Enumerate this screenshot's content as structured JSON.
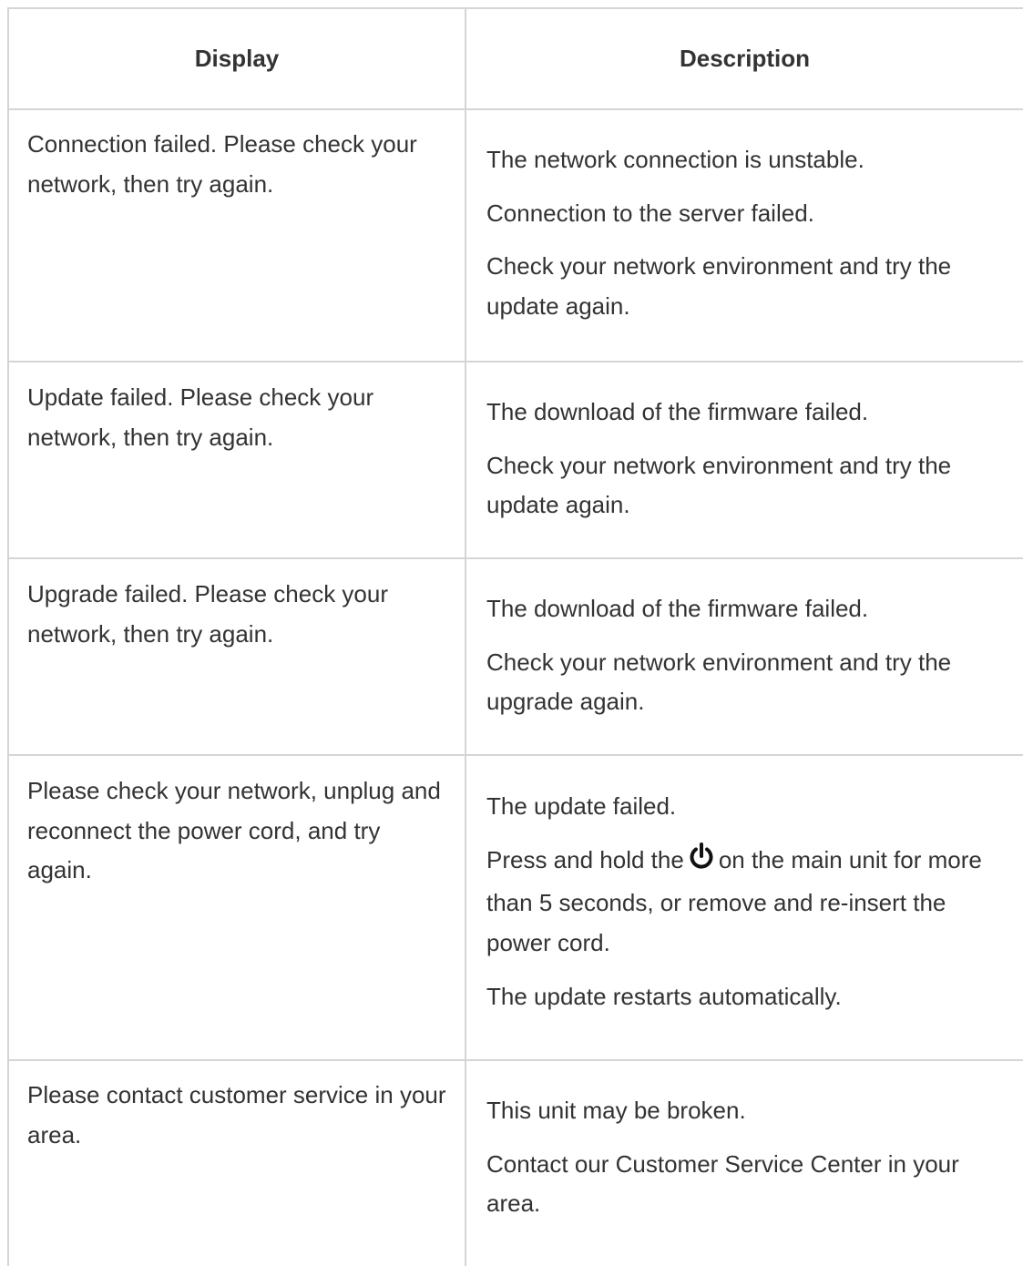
{
  "table": {
    "headers": {
      "display": "Display",
      "description": "Description"
    },
    "rows": [
      {
        "display": "Connection failed. Please check your network, then try again.",
        "description": [
          "The network connection is unstable.",
          "Connection to the server failed.",
          "Check your network environment and try the update again."
        ]
      },
      {
        "display": "Update failed. Please check your network, then try again.",
        "description": [
          "The download of the firmware failed.",
          "Check your network environment and try the update again."
        ]
      },
      {
        "display": "Upgrade failed. Please check your network, then try again.",
        "description": [
          "The download of the firmware failed.",
          "Check your network environment and try the upgrade again."
        ]
      },
      {
        "display": "Please check your network, unplug and reconnect the power cord, and try again.",
        "description": [
          "The update failed.",
          "Press and hold the",
          "on the main unit for more than 5 seconds, or remove and re-insert the power cord.",
          "The update restarts automatically."
        ],
        "icon": "power-icon"
      },
      {
        "display": "Please contact customer service in your area.",
        "description": [
          "This unit may be broken.",
          "Contact our Customer Service Center in your area."
        ]
      }
    ]
  }
}
